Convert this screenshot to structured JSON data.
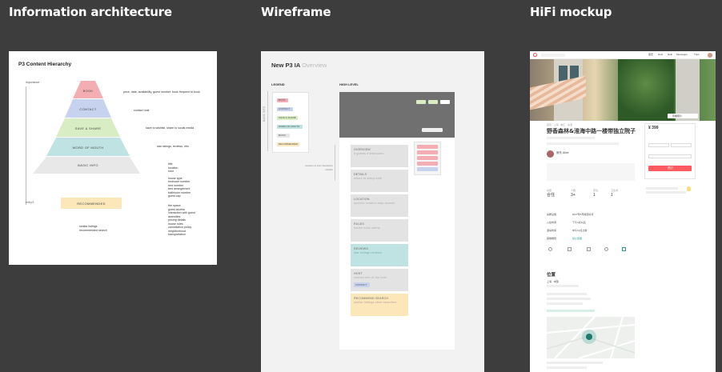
{
  "sections": {
    "ia": "Information architecture",
    "wireframe": "Wireframe",
    "hifi": "HiFi mockup"
  },
  "ia": {
    "title": "P3 Content Hierarchy",
    "axis_top": "importance",
    "axis_bottom": "exit p3",
    "levels": [
      "BOOK",
      "CONTACT",
      "SAVE & SHARE",
      "WORD OF MOUTH",
      "BASIC INFO"
    ],
    "recommended": "RECOMMENDED",
    "annotations": {
      "book": "price, date, availability, guest number: book frequent to book",
      "contact": "contact host",
      "save": "save to wishlist, share to social media",
      "word": "star ratings, reviews, ribs",
      "basic": [
        "title",
        "location",
        "host",
        "",
        "house type",
        "bedroom number",
        "bed number",
        "bed arrangement",
        "bathroom number",
        "guest cap"
      ],
      "basic2": [
        "the space",
        "guest access",
        "interaction with guest",
        "amenities",
        "pricing details",
        "house rules",
        "cancellation policy",
        "neighborhood",
        "transportation"
      ],
      "rec": [
        "similar listings",
        "recommended search"
      ]
    }
  },
  "wireframe": {
    "title": "New P3 IA",
    "title_suffix": "Overview",
    "legend": "LEGEND",
    "high_level": "HIGH LEVEL",
    "side_text": "BASIC INFO",
    "legend_items": [
      "BOOK",
      "CONTACT",
      "SAVE & SHARE",
      "WORD OF MOUTH",
      "BASIC",
      "RECOMMENDED"
    ],
    "note": "location of icon interaction section",
    "sections": [
      {
        "label": "OVERVIEW",
        "sub": "# guests # bedrooms"
      },
      {
        "label": "DETAILS",
        "sub": "where to sleep bath"
      },
      {
        "label": "LOCATION",
        "sub": "specific location map access"
      },
      {
        "label": "RULES",
        "sub": "house rules safety"
      },
      {
        "label": "REVIEWS",
        "sub": "star ratings reviews"
      },
      {
        "label": "HOST",
        "sub": "contact info of the host"
      },
      {
        "label": "RECOMMEND SEARCH",
        "sub": "similar listings other searches"
      }
    ],
    "contact_btn": "CONTACT"
  },
  "hifi": {
    "listing_title": "野香森林&淮海中路一楼带独立院子",
    "price": "¥ 399",
    "book_btn": "预订",
    "photo_btn": "查看照片",
    "nav": [
      "首页",
      "Host",
      "Help",
      "Messages",
      "Trips"
    ],
    "breadcrumb": "首页 · 上海 · 徐汇 · 房源",
    "host_name": "房东 Alice",
    "stats": [
      [
        "房型",
        "合住"
      ],
      [
        "人数",
        "3+"
      ],
      [
        "床位",
        "1"
      ],
      [
        "卫生间",
        "1"
      ]
    ],
    "detail_rows": [
      [
        "房屋设施",
        "2017年5月收获好评"
      ],
      [
        "入住时间",
        "下午3点以后"
      ],
      [
        "退房时间",
        "中午12点之前"
      ],
      [
        "其他规则",
        "禁止吸烟"
      ]
    ],
    "section_location": "位置",
    "location_sub": "上海 · 中国",
    "accent": "#ff5a5f"
  }
}
